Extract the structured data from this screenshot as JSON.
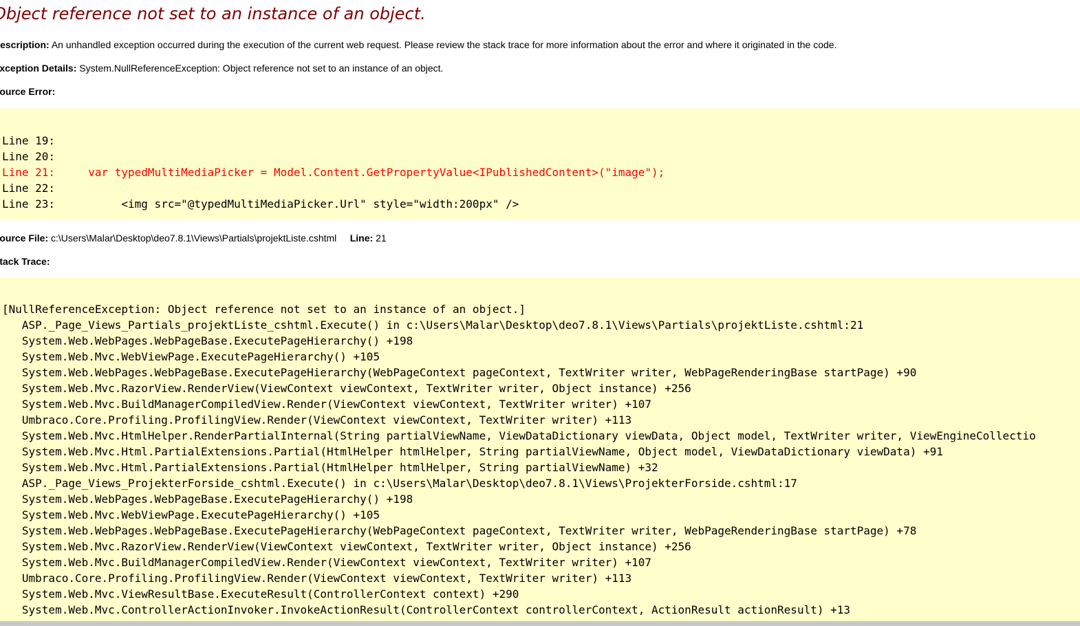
{
  "error": {
    "title": "Object reference not set to an instance of an object.",
    "description_label": "Description:",
    "description_text": "An unhandled exception occurred during the execution of the current web request. Please review the stack trace for more information about the error and where it originated in the code.",
    "exception_label": "Exception Details:",
    "exception_text": "System.NullReferenceException: Object reference not set to an instance of an object.",
    "source_error_label": "Source Error:",
    "source_file_label": "Source File:",
    "source_file_path": "c:\\Users\\Malar\\Desktop\\deo7.8.1\\Views\\Partials\\projektListe.cshtml",
    "line_label": "Line:",
    "line_number": "21",
    "stack_trace_label": "Stack Trace:"
  },
  "source_code": [
    {
      "text": "Line 19:",
      "highlight": false
    },
    {
      "text": "Line 20:",
      "highlight": false
    },
    {
      "text": "Line 21:     var typedMultiMediaPicker = Model.Content.GetPropertyValue<IPublishedContent>(\"image\");",
      "highlight": true
    },
    {
      "text": "Line 22:",
      "highlight": false
    },
    {
      "text": "Line 23:          <img src=\"@typedMultiMediaPicker.Url\" style=\"width:200px\" />",
      "highlight": false
    }
  ],
  "stack_trace": [
    "[NullReferenceException: Object reference not set to an instance of an object.]",
    "   ASP._Page_Views_Partials_projektListe_cshtml.Execute() in c:\\Users\\Malar\\Desktop\\deo7.8.1\\Views\\Partials\\projektListe.cshtml:21",
    "   System.Web.WebPages.WebPageBase.ExecutePageHierarchy() +198",
    "   System.Web.Mvc.WebViewPage.ExecutePageHierarchy() +105",
    "   System.Web.WebPages.WebPageBase.ExecutePageHierarchy(WebPageContext pageContext, TextWriter writer, WebPageRenderingBase startPage) +90",
    "   System.Web.Mvc.RazorView.RenderView(ViewContext viewContext, TextWriter writer, Object instance) +256",
    "   System.Web.Mvc.BuildManagerCompiledView.Render(ViewContext viewContext, TextWriter writer) +107",
    "   Umbraco.Core.Profiling.ProfilingView.Render(ViewContext viewContext, TextWriter writer) +113",
    "   System.Web.Mvc.HtmlHelper.RenderPartialInternal(String partialViewName, ViewDataDictionary viewData, Object model, TextWriter writer, ViewEngineCollectio",
    "   System.Web.Mvc.Html.PartialExtensions.Partial(HtmlHelper htmlHelper, String partialViewName, Object model, ViewDataDictionary viewData) +91",
    "   System.Web.Mvc.Html.PartialExtensions.Partial(HtmlHelper htmlHelper, String partialViewName) +32",
    "   ASP._Page_Views_ProjekterForside_cshtml.Execute() in c:\\Users\\Malar\\Desktop\\deo7.8.1\\Views\\ProjekterForside.cshtml:17",
    "   System.Web.WebPages.WebPageBase.ExecutePageHierarchy() +198",
    "   System.Web.Mvc.WebViewPage.ExecutePageHierarchy() +105",
    "   System.Web.WebPages.WebPageBase.ExecutePageHierarchy(WebPageContext pageContext, TextWriter writer, WebPageRenderingBase startPage) +78",
    "   System.Web.Mvc.RazorView.RenderView(ViewContext viewContext, TextWriter writer, Object instance) +256",
    "   System.Web.Mvc.BuildManagerCompiledView.Render(ViewContext viewContext, TextWriter writer) +107",
    "   Umbraco.Core.Profiling.ProfilingView.Render(ViewContext viewContext, TextWriter writer) +113",
    "   System.Web.Mvc.ViewResultBase.ExecuteResult(ControllerContext context) +290",
    "   System.Web.Mvc.ControllerActionInvoker.InvokeActionResult(ControllerContext controllerContext, ActionResult actionResult) +13"
  ],
  "colors": {
    "title": "#800000",
    "highlight_line": "#ff0000",
    "code_background": "#ffffcc"
  }
}
